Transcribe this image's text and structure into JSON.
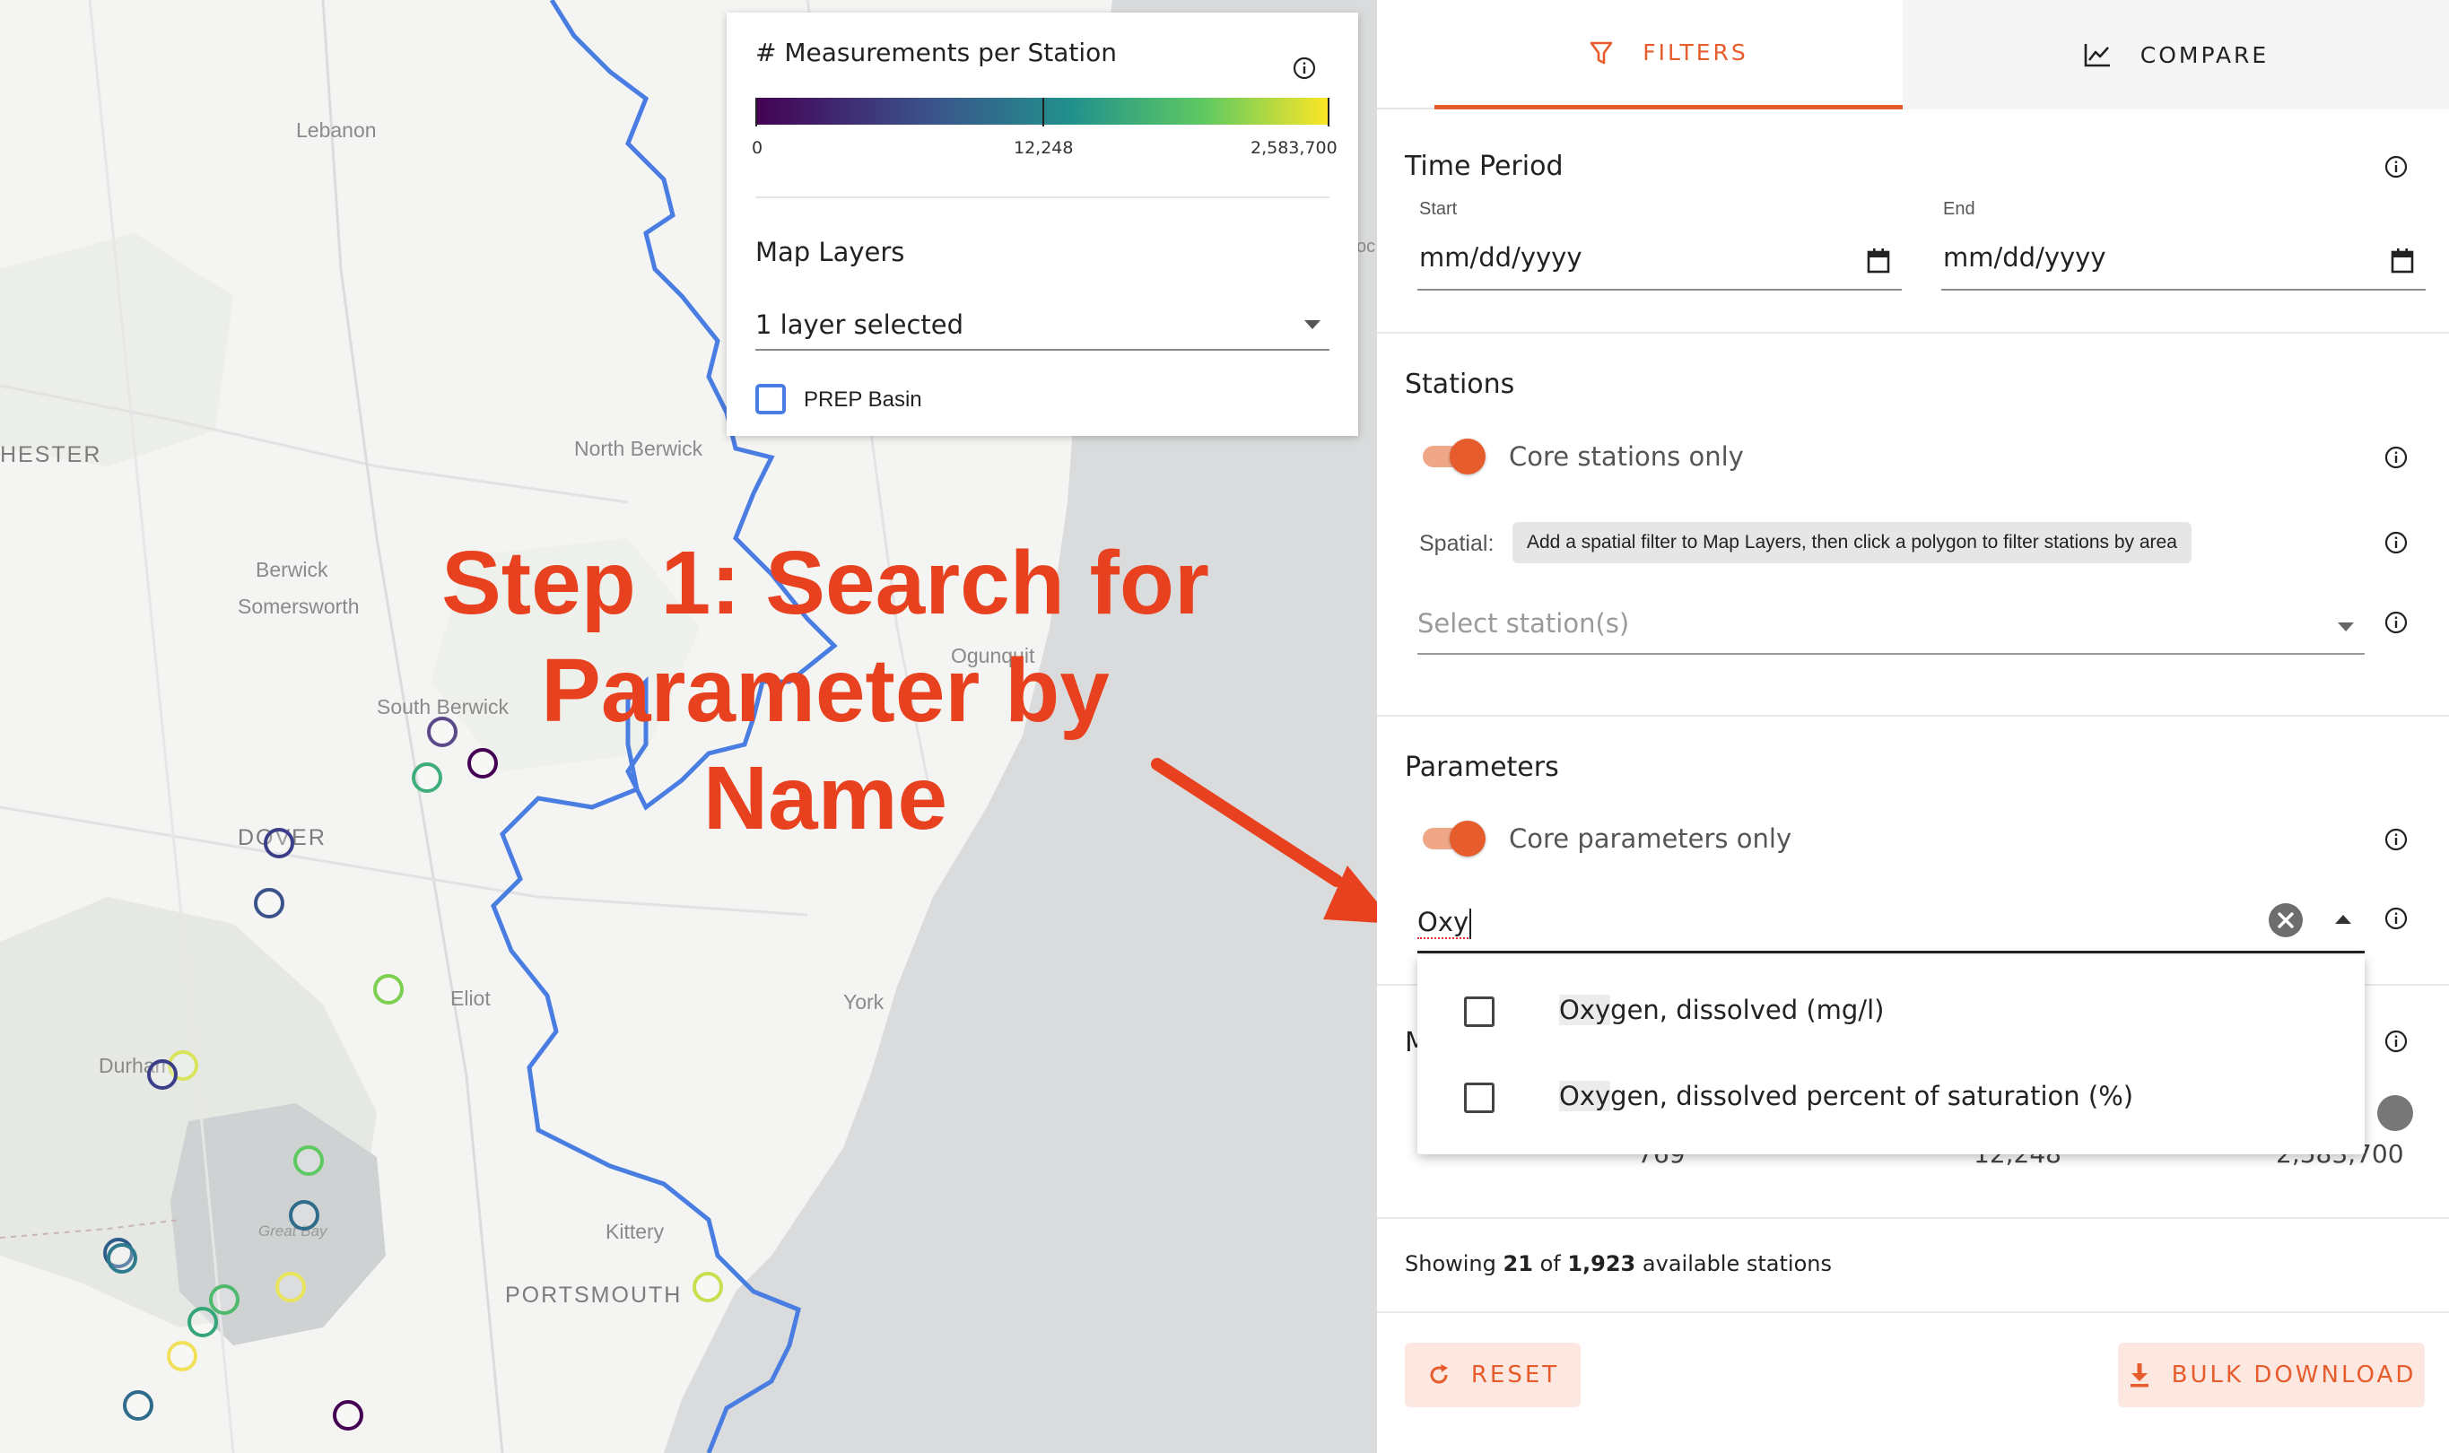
{
  "map": {
    "places": {
      "lebanon": "Lebanon",
      "hester": "HESTER",
      "north_berwick": "North Berwick",
      "berwick": "Berwick",
      "somersworth": "Somersworth",
      "ogunquit": "Ogunquit",
      "south_berwick": "South Berwick",
      "dover": "DOVER",
      "eliot": "Eliot",
      "york": "York",
      "durham": "Durham",
      "great_bay": "Great Bay",
      "kittery": "Kittery",
      "portsmouth": "PORTSMOUTH",
      "edge_oc": "oc"
    },
    "annotation_line1": "Step 1: Search for",
    "annotation_line2": "Parameter by Name",
    "station_colors": [
      "#440154",
      "#3b528b",
      "#21918c",
      "#5ec962",
      "#fde725"
    ]
  },
  "legend": {
    "title": "# Measurements per Station",
    "scale_min": "0",
    "scale_mid": "12,248",
    "scale_max": "2,583,700",
    "layers_title": "Map Layers",
    "layers_selected": "1 layer selected",
    "layer_option": "PREP Basin"
  },
  "tabs": {
    "filters": "FILTERS",
    "compare": "COMPARE"
  },
  "time_period": {
    "title": "Time Period",
    "start_label": "Start",
    "end_label": "End",
    "start_placeholder": "mm/dd/yyyy",
    "end_placeholder": "mm/dd/yyyy"
  },
  "stations": {
    "title": "Stations",
    "core_toggle_label": "Core stations only",
    "core_toggle_on": true,
    "spatial_label": "Spatial:",
    "spatial_hint": "Add a spatial filter to Map Layers, then click a polygon to filter stations by area",
    "select_placeholder": "Select station(s)"
  },
  "parameters": {
    "title": "Parameters",
    "core_toggle_label": "Core parameters only",
    "core_toggle_on": true,
    "search_value": "Oxy",
    "options": [
      {
        "match": "Oxy",
        "rest": "gen, dissolved (mg/l)"
      },
      {
        "match": "Oxy",
        "rest": "gen, dissolved percent of saturation (%)"
      }
    ]
  },
  "hidden_section": {
    "title_fragment": "M",
    "value_left": "769",
    "value_mid": "12,248",
    "value_right": "2,583,700"
  },
  "summary": {
    "prefix": "Showing",
    "shown": "21",
    "middle": "of",
    "total": "1,923",
    "suffix": "available stations"
  },
  "buttons": {
    "reset": "RESET",
    "bulk_download": "BULK DOWNLOAD"
  },
  "colors": {
    "accent": "#e65c2c",
    "annotation": "#e8411f",
    "river": "#4a7de2"
  }
}
